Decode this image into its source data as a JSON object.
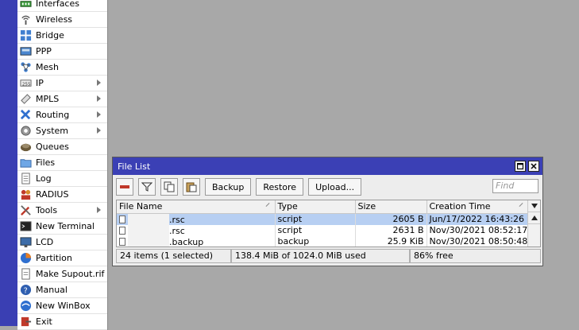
{
  "menu": {
    "items": [
      {
        "label": "Interfaces",
        "icon": "interfaces-icon",
        "submenu": false
      },
      {
        "label": "Wireless",
        "icon": "wireless-icon",
        "submenu": false
      },
      {
        "label": "Bridge",
        "icon": "bridge-icon",
        "submenu": false
      },
      {
        "label": "PPP",
        "icon": "ppp-icon",
        "submenu": false
      },
      {
        "label": "Mesh",
        "icon": "mesh-icon",
        "submenu": false
      },
      {
        "label": "IP",
        "icon": "ip-icon",
        "submenu": true
      },
      {
        "label": "MPLS",
        "icon": "mpls-icon",
        "submenu": true
      },
      {
        "label": "Routing",
        "icon": "routing-icon",
        "submenu": true
      },
      {
        "label": "System",
        "icon": "system-gear-icon",
        "submenu": true
      },
      {
        "label": "Queues",
        "icon": "queues-icon",
        "submenu": false
      },
      {
        "label": "Files",
        "icon": "folder-icon",
        "submenu": false
      },
      {
        "label": "Log",
        "icon": "log-icon",
        "submenu": false
      },
      {
        "label": "RADIUS",
        "icon": "radius-icon",
        "submenu": false
      },
      {
        "label": "Tools",
        "icon": "tools-icon",
        "submenu": true
      },
      {
        "label": "New Terminal",
        "icon": "terminal-icon",
        "submenu": false
      },
      {
        "label": "LCD",
        "icon": "lcd-icon",
        "submenu": false
      },
      {
        "label": "Partition",
        "icon": "partition-icon",
        "submenu": false
      },
      {
        "label": "Make Supout.rif",
        "icon": "supout-icon",
        "submenu": false
      },
      {
        "label": "Manual",
        "icon": "help-icon",
        "submenu": false
      },
      {
        "label": "New WinBox",
        "icon": "winbox-icon",
        "submenu": false
      },
      {
        "label": "Exit",
        "icon": "exit-icon",
        "submenu": false
      }
    ]
  },
  "window": {
    "title": "File List",
    "toolbar": {
      "backup_label": "Backup",
      "restore_label": "Restore",
      "upload_label": "Upload...",
      "find_placeholder": "Find"
    },
    "columns": [
      "File Name",
      "Type",
      "Size",
      "Creation Time"
    ],
    "rows": [
      {
        "name": ".rsc",
        "type": "script",
        "size": "2605 B",
        "created": "Jun/17/2022 16:43:26",
        "selected": true
      },
      {
        "name": ".rsc",
        "type": "script",
        "size": "2631 B",
        "created": "Nov/30/2021 08:52:17",
        "selected": false
      },
      {
        "name": ".backup",
        "type": "backup",
        "size": "25.9 KiB",
        "created": "Nov/30/2021 08:50:48",
        "selected": false
      }
    ],
    "status": {
      "items": "24 items (1 selected)",
      "usage": "138.4 MiB of 1024.0 MiB used",
      "free": "86% free"
    }
  },
  "colors": {
    "titlebar": "#3b40b5",
    "selection": "#b7cff2",
    "desktop": "#a8a8a8"
  }
}
